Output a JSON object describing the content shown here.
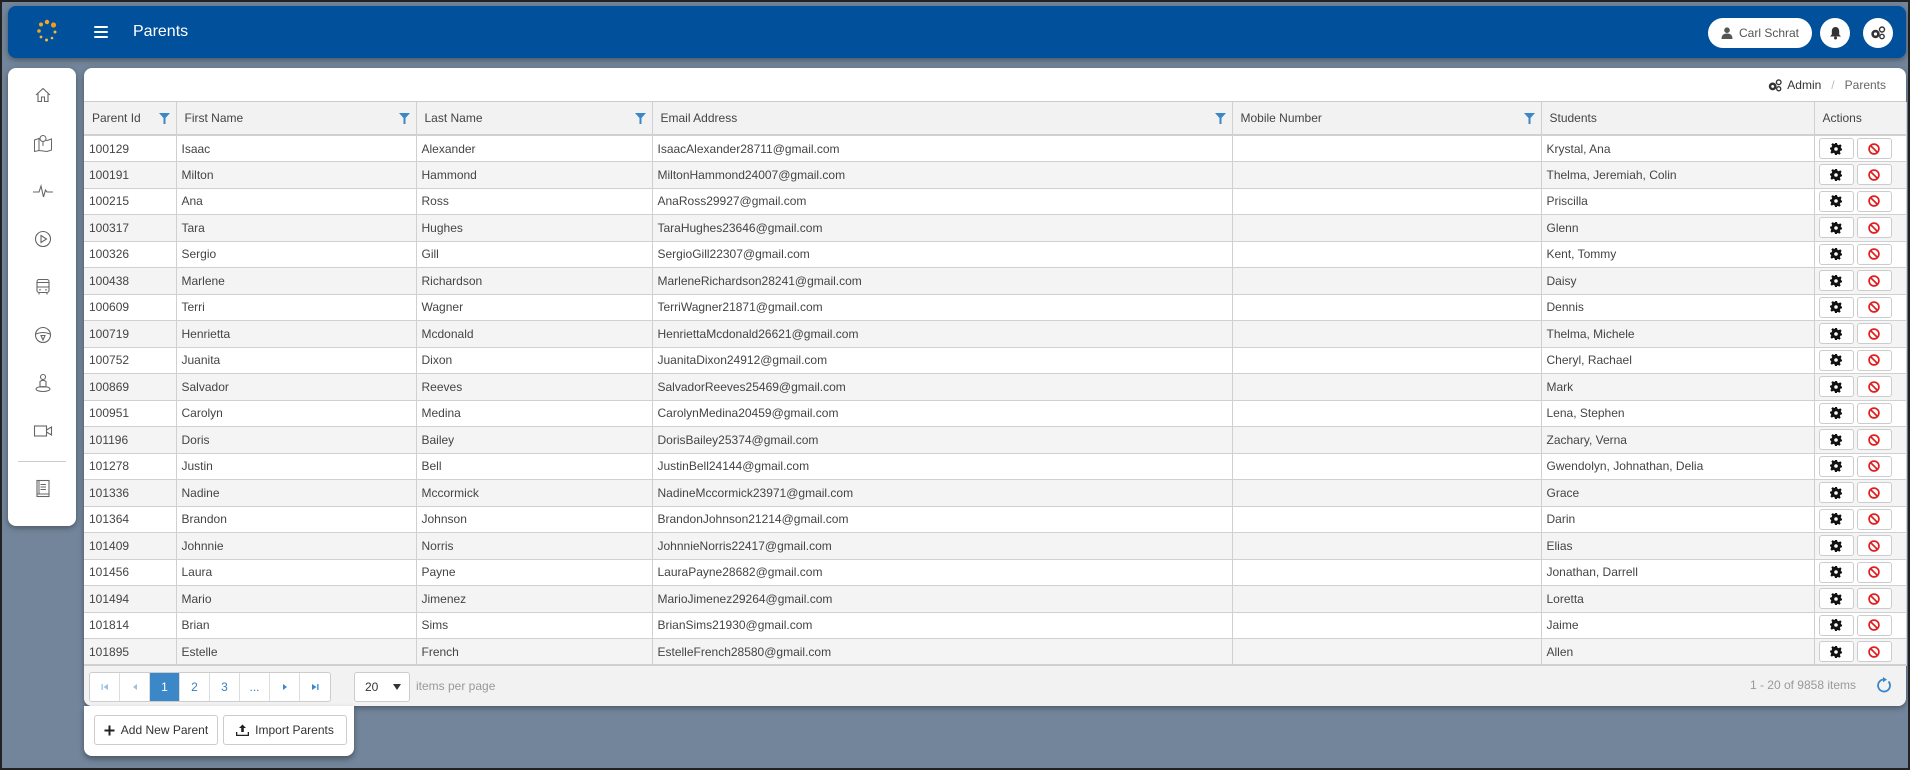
{
  "header": {
    "title": "Parents",
    "user_name": "Carl Schrat",
    "logo_icon": "spinner-dots-logo",
    "menu_icon": "hamburger-icon",
    "notification_icon": "bell-icon",
    "settings_icon": "gears-icon"
  },
  "sidebar": {
    "items": [
      {
        "name": "home",
        "icon": "home-icon"
      },
      {
        "name": "map",
        "icon": "map-pin-icon"
      },
      {
        "name": "activity",
        "icon": "pulse-icon"
      },
      {
        "name": "playback",
        "icon": "play-circle-icon"
      },
      {
        "name": "bus",
        "icon": "bus-icon"
      },
      {
        "name": "driver",
        "icon": "steering-wheel-icon"
      },
      {
        "name": "location-person",
        "icon": "person-pin-icon"
      },
      {
        "name": "video",
        "icon": "video-camera-icon"
      },
      {
        "name": "reports",
        "icon": "book-icon"
      }
    ]
  },
  "breadcrumb": {
    "root": "Admin",
    "current": "Parents"
  },
  "table": {
    "columns": [
      {
        "label": "Parent Id",
        "filter": true
      },
      {
        "label": "First Name",
        "filter": true
      },
      {
        "label": "Last Name",
        "filter": true
      },
      {
        "label": "Email Address",
        "filter": true
      },
      {
        "label": "Mobile Number",
        "filter": true
      },
      {
        "label": "Students",
        "filter": false
      },
      {
        "label": "Actions",
        "filter": false
      }
    ],
    "rows": [
      {
        "id": "100129",
        "first": "Isaac",
        "last": "Alexander",
        "email": "IsaacAlexander28711@gmail.com",
        "mobile": "",
        "students": "Krystal, Ana"
      },
      {
        "id": "100191",
        "first": "Milton",
        "last": "Hammond",
        "email": "MiltonHammond24007@gmail.com",
        "mobile": "",
        "students": "Thelma, Jeremiah, Colin"
      },
      {
        "id": "100215",
        "first": "Ana",
        "last": "Ross",
        "email": "AnaRoss29927@gmail.com",
        "mobile": "",
        "students": "Priscilla"
      },
      {
        "id": "100317",
        "first": "Tara",
        "last": "Hughes",
        "email": "TaraHughes23646@gmail.com",
        "mobile": "",
        "students": "Glenn"
      },
      {
        "id": "100326",
        "first": "Sergio",
        "last": "Gill",
        "email": "SergioGill22307@gmail.com",
        "mobile": "",
        "students": "Kent, Tommy"
      },
      {
        "id": "100438",
        "first": "Marlene",
        "last": "Richardson",
        "email": "MarleneRichardson28241@gmail.com",
        "mobile": "",
        "students": "Daisy"
      },
      {
        "id": "100609",
        "first": "Terri",
        "last": "Wagner",
        "email": "TerriWagner21871@gmail.com",
        "mobile": "",
        "students": "Dennis"
      },
      {
        "id": "100719",
        "first": "Henrietta",
        "last": "Mcdonald",
        "email": "HenriettaMcdonald26621@gmail.com",
        "mobile": "",
        "students": "Thelma, Michele"
      },
      {
        "id": "100752",
        "first": "Juanita",
        "last": "Dixon",
        "email": "JuanitaDixon24912@gmail.com",
        "mobile": "",
        "students": "Cheryl, Rachael"
      },
      {
        "id": "100869",
        "first": "Salvador",
        "last": "Reeves",
        "email": "SalvadorReeves25469@gmail.com",
        "mobile": "",
        "students": "Mark"
      },
      {
        "id": "100951",
        "first": "Carolyn",
        "last": "Medina",
        "email": "CarolynMedina20459@gmail.com",
        "mobile": "",
        "students": "Lena, Stephen"
      },
      {
        "id": "101196",
        "first": "Doris",
        "last": "Bailey",
        "email": "DorisBailey25374@gmail.com",
        "mobile": "",
        "students": "Zachary, Verna"
      },
      {
        "id": "101278",
        "first": "Justin",
        "last": "Bell",
        "email": "JustinBell24144@gmail.com",
        "mobile": "",
        "students": "Gwendolyn, Johnathan, Delia"
      },
      {
        "id": "101336",
        "first": "Nadine",
        "last": "Mccormick",
        "email": "NadineMccormick23971@gmail.com",
        "mobile": "",
        "students": "Grace"
      },
      {
        "id": "101364",
        "first": "Brandon",
        "last": "Johnson",
        "email": "BrandonJohnson21214@gmail.com",
        "mobile": "",
        "students": "Darin"
      },
      {
        "id": "101409",
        "first": "Johnnie",
        "last": "Norris",
        "email": "JohnnieNorris22417@gmail.com",
        "mobile": "",
        "students": "Elias"
      },
      {
        "id": "101456",
        "first": "Laura",
        "last": "Payne",
        "email": "LauraPayne28682@gmail.com",
        "mobile": "",
        "students": "Jonathan, Darrell"
      },
      {
        "id": "101494",
        "first": "Mario",
        "last": "Jimenez",
        "email": "MarioJimenez29264@gmail.com",
        "mobile": "",
        "students": "Loretta"
      },
      {
        "id": "101814",
        "first": "Brian",
        "last": "Sims",
        "email": "BrianSims21930@gmail.com",
        "mobile": "",
        "students": "Jaime"
      },
      {
        "id": "101895",
        "first": "Estelle",
        "last": "French",
        "email": "EstelleFrench28580@gmail.com",
        "mobile": "",
        "students": "Allen"
      }
    ],
    "row_actions": {
      "edit_icon": "gear-icon",
      "delete_icon": "ban-icon"
    }
  },
  "pager": {
    "pages": [
      "1",
      "2",
      "3",
      "..."
    ],
    "current_page": "1",
    "per_page": "20",
    "per_page_label": "items per page",
    "count_label": "1 - 20 of 9858 items"
  },
  "actions": {
    "add_label": "Add New Parent",
    "import_label": "Import Parents"
  },
  "colors": {
    "header_bg": "#01509b",
    "page_bg": "#72859a",
    "accent": "#3b87c8",
    "filter_icon": "#3b87c8",
    "delete_icon": "#e02020"
  }
}
